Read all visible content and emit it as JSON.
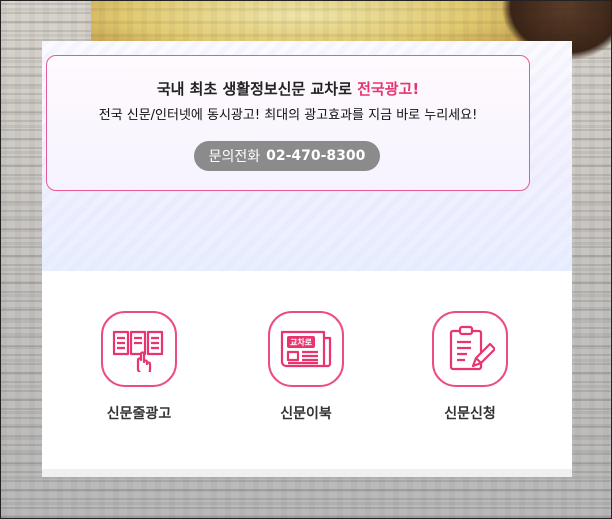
{
  "ad": {
    "headline_main": "국내 최초 생활정보신문 교차로 ",
    "headline_accent": "전국광고!",
    "subline": "전국 신문/인터넷에 동시광고! 최대의 광고효과를 지금 바로 누리세요!",
    "call_label": "문의전화",
    "call_number": "02-470-8300"
  },
  "services": [
    {
      "label": "신문줄광고",
      "icon": "newspaper-click-icon"
    },
    {
      "label": "신문이북",
      "icon": "ebook-newspaper-icon"
    },
    {
      "label": "신문신청",
      "icon": "clipboard-pen-icon"
    }
  ],
  "icon_text": {
    "ebook_badge": "교차로"
  },
  "colors": {
    "accent": "#e8356f",
    "icon_border": "#ec4b86",
    "button_bg": "#8b8b8b"
  }
}
